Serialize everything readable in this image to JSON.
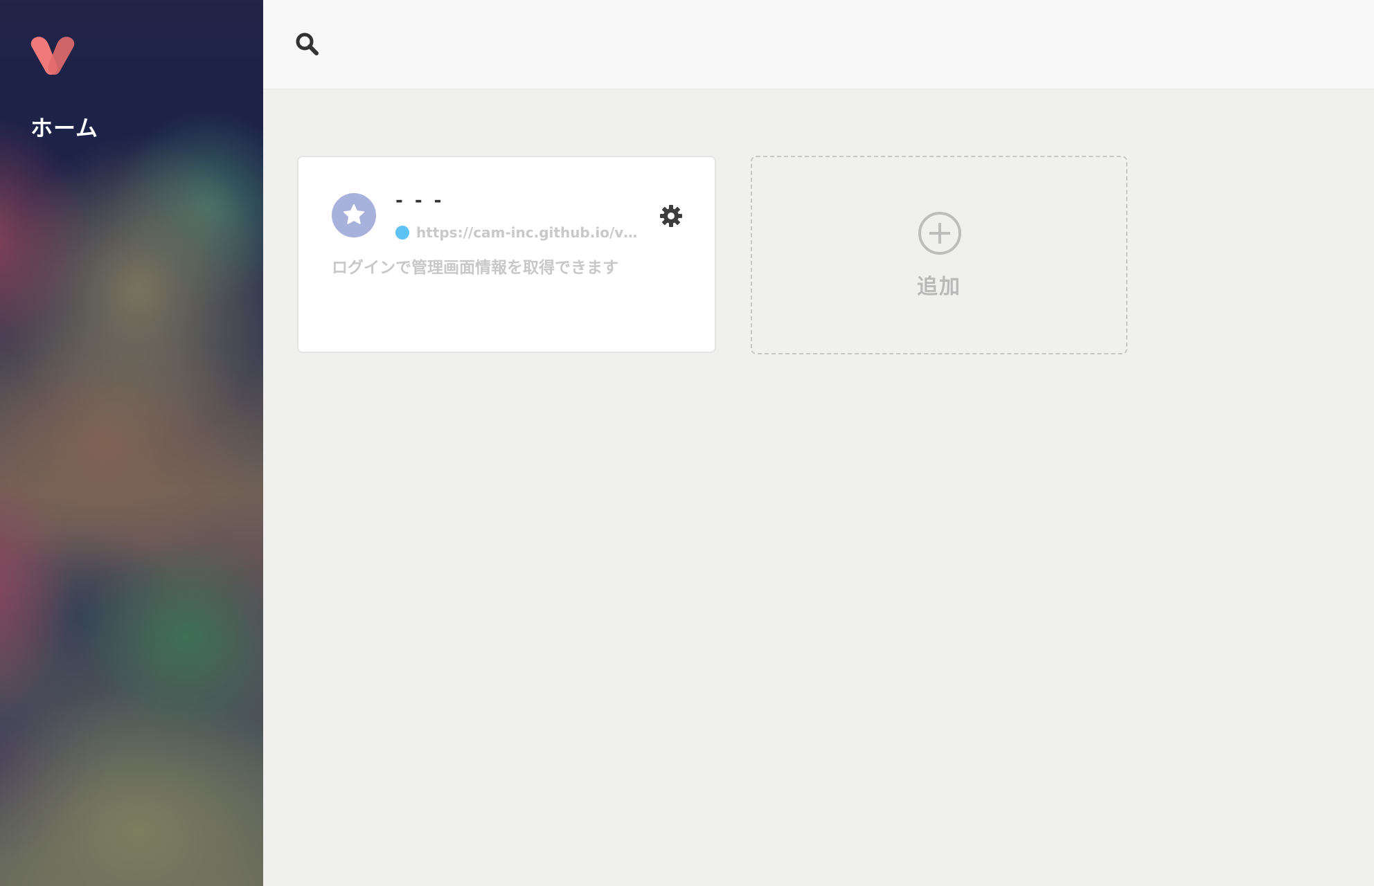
{
  "sidebar": {
    "logo_icon": "viron-v-logo-icon",
    "home_label": "ホーム",
    "logo_colors": [
      "#f07a7a",
      "#d96b6b"
    ]
  },
  "header": {
    "search_icon": "search-icon"
  },
  "endpoints": [
    {
      "avatar_icon": "star-icon",
      "avatar_color": "#a7b1dc",
      "title": "- - -",
      "status_color": "#5ec2f4",
      "url": "https://cam-inc.github.io/viron/...",
      "description": "ログインで管理画面情報を取得できます",
      "settings_icon": "gear-icon"
    }
  ],
  "add_card": {
    "icon": "plus-circle-icon",
    "label": "追加"
  }
}
